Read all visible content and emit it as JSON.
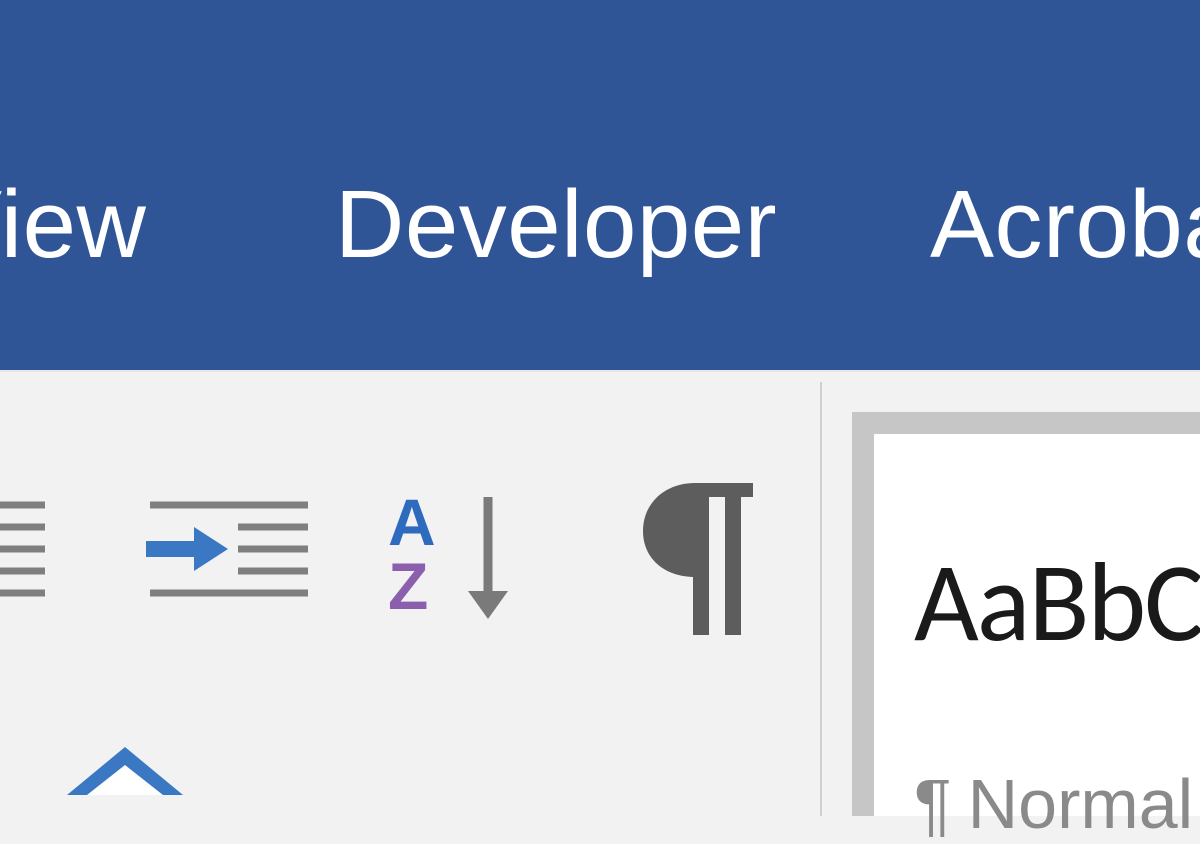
{
  "ribbon": {
    "tabs": [
      {
        "id": "view",
        "label": "View"
      },
      {
        "id": "developer",
        "label": "Developer"
      },
      {
        "id": "acrobat",
        "label": "Acrobat"
      }
    ]
  },
  "paragraph_group": {
    "decrease_indent_tooltip": "Decrease Indent",
    "increase_indent_tooltip": "Increase Indent",
    "sort_tooltip": "Sort",
    "show_marks_tooltip": "Show/Hide ¶"
  },
  "styles": {
    "preview_sample": "AaBbCcDd",
    "pilcrow": "¶",
    "name_fragment": "Normal"
  }
}
